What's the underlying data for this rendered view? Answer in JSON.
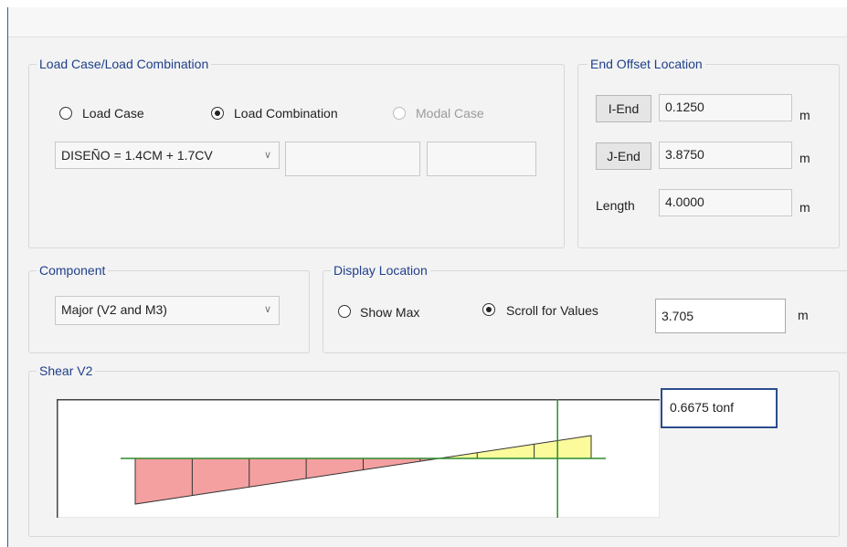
{
  "load_case_group": {
    "title": "Load Case/Load Combination",
    "options": [
      {
        "label": "Load Case",
        "checked": false,
        "enabled": true
      },
      {
        "label": "Load Combination",
        "checked": true,
        "enabled": true
      },
      {
        "label": "Modal Case",
        "checked": false,
        "enabled": false
      }
    ],
    "selected_combination": "DISEÑO = 1.4CM + 1.7CV"
  },
  "end_offset": {
    "title": "End Offset Location",
    "i_end_label": "I-End",
    "i_end_value": "0.1250",
    "j_end_label": "J-End",
    "j_end_value": "3.8750",
    "length_label": "Length",
    "length_value": "4.0000",
    "unit": "m"
  },
  "component": {
    "title": "Component",
    "selected": "Major (V2 and M3)"
  },
  "display_location": {
    "title": "Display Location",
    "show_max_label": "Show Max",
    "show_max_checked": false,
    "scroll_label": "Scroll for Values",
    "scroll_checked": true,
    "value": "3.705",
    "unit": "m"
  },
  "shear": {
    "title": "Shear V2",
    "readout": "0.6675 tonf"
  },
  "chart_data": {
    "type": "area",
    "x": [
      0.0,
      4.0
    ],
    "y": [
      -1.0,
      0.5
    ],
    "xlim": [
      0.0,
      4.0
    ],
    "cursor_x": 3.705,
    "negative_color": "#f4a0a0",
    "positive_color": "#fbfb9c",
    "axis_color": "#2e8b2e"
  }
}
